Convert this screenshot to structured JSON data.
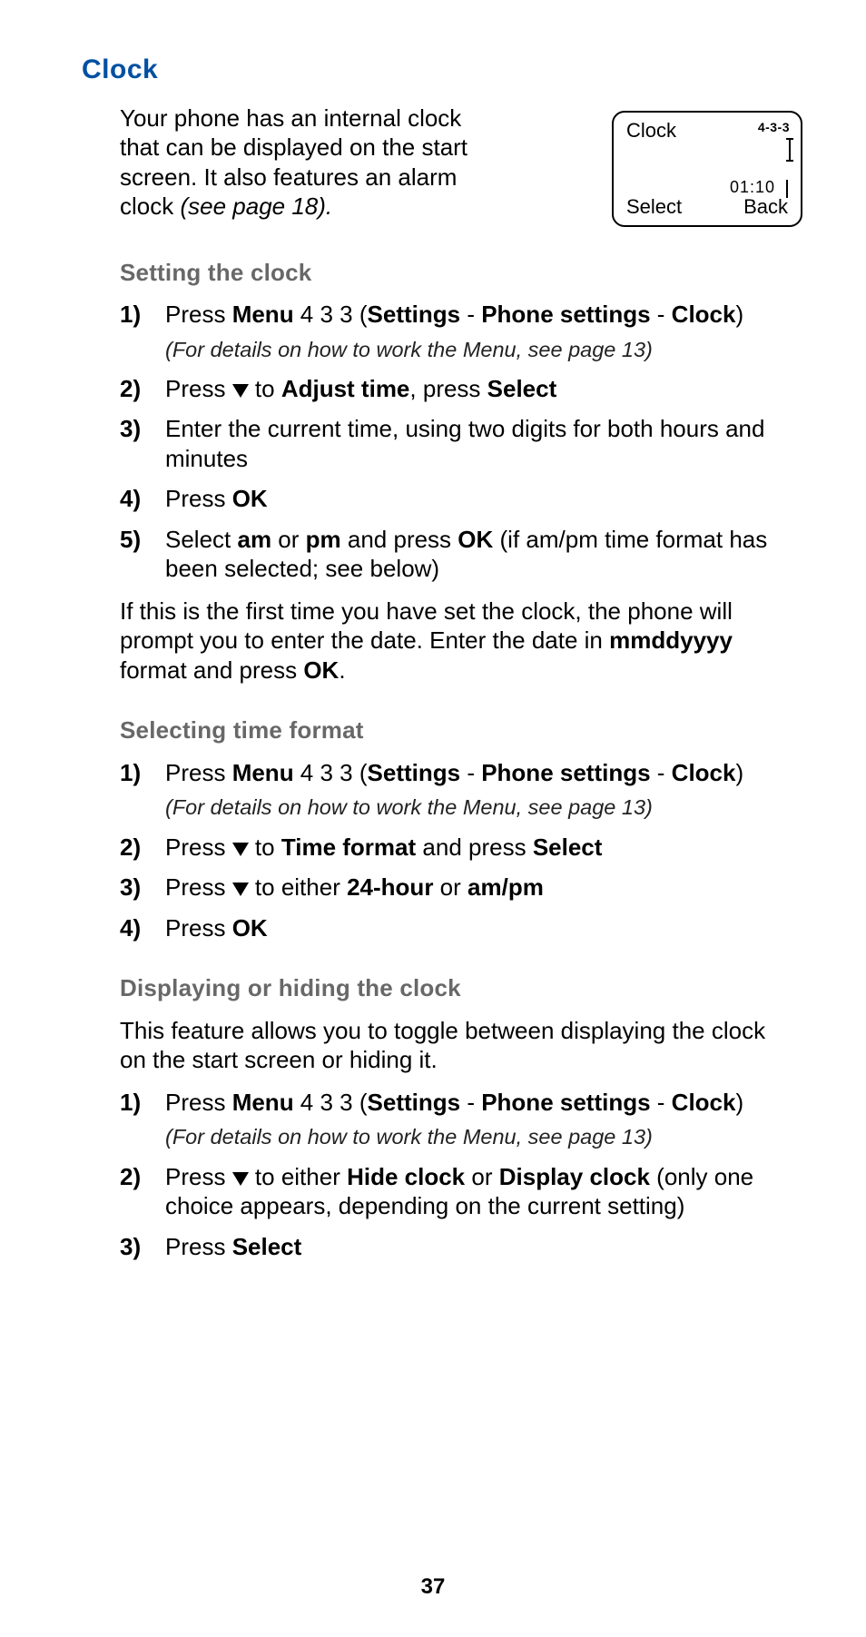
{
  "page_number": "37",
  "title": "Clock",
  "intro": {
    "p1": "Your phone has an internal clock that can be displayed on the start screen. It also features an alarm clock ",
    "p1_em": "(see page 18).",
    "screen": {
      "title": "Clock",
      "menu_code": "4-3-3",
      "time": "01:10",
      "left_soft": "Select",
      "right_soft": "Back"
    }
  },
  "sec1": {
    "heading": "Setting the clock",
    "steps": {
      "n1": "1)",
      "s1_a": "Press ",
      "s1_b": "Menu",
      "s1_c": " 4 3 3 (",
      "s1_d": "Settings",
      "s1_e": " - ",
      "s1_f": "Phone settings",
      "s1_g": " - ",
      "s1_h": "Clock",
      "s1_i": ")",
      "s1_note": "(For details on how to work the Menu, see page 13)",
      "n2": "2)",
      "s2_a": "Press ",
      "s2_b": " to ",
      "s2_c": "Adjust time",
      "s2_d": ", press ",
      "s2_e": "Select",
      "n3": "3)",
      "s3": "Enter the current time, using two digits for both hours and minutes",
      "n4": "4)",
      "s4_a": "Press ",
      "s4_b": "OK",
      "n5": "5)",
      "s5_a": "Select ",
      "s5_b": "am",
      "s5_c": " or ",
      "s5_d": "pm",
      "s5_e": " and press ",
      "s5_f": "OK",
      "s5_g": " (if am/pm time format has been selected; see below)"
    },
    "after_a": "If this is the first time you have set the clock, the phone will prompt you to enter the date. Enter the date in ",
    "after_b": "mmddyyyy",
    "after_c": " format and press ",
    "after_d": "OK",
    "after_e": "."
  },
  "sec2": {
    "heading": "Selecting time format",
    "steps": {
      "n1": "1)",
      "s1_a": "Press ",
      "s1_b": "Menu",
      "s1_c": " 4 3 3 (",
      "s1_d": "Settings",
      "s1_e": " - ",
      "s1_f": "Phone settings",
      "s1_g": " - ",
      "s1_h": "Clock",
      "s1_i": ")",
      "s1_note": "(For details on how to work the Menu, see page 13)",
      "n2": "2)",
      "s2_a": "Press ",
      "s2_b": " to ",
      "s2_c": "Time format",
      "s2_d": " and press ",
      "s2_e": "Select",
      "n3": "3)",
      "s3_a": "Press ",
      "s3_b": " to either ",
      "s3_c": "24-hour",
      "s3_d": " or ",
      "s3_e": "am/pm",
      "n4": "4)",
      "s4_a": "Press ",
      "s4_b": "OK"
    }
  },
  "sec3": {
    "heading": "Displaying or hiding the clock",
    "intro": "This feature allows you to toggle between displaying the clock on the start screen or hiding it.",
    "steps": {
      "n1": "1)",
      "s1_a": "Press ",
      "s1_b": "Menu",
      "s1_c": " 4 3 3 (",
      "s1_d": "Settings",
      "s1_e": " - ",
      "s1_f": "Phone settings",
      "s1_g": " - ",
      "s1_h": "Clock",
      "s1_i": ")",
      "s1_note": "(For details on how to work the Menu, see page 13)",
      "n2": "2)",
      "s2_a": "Press ",
      "s2_b": " to either ",
      "s2_c": "Hide clock",
      "s2_d": " or ",
      "s2_e": "Display clock",
      "s2_f": " (only one choice appears, depending on the current setting)",
      "n3": "3)",
      "s3_a": "Press ",
      "s3_b": "Select"
    }
  }
}
